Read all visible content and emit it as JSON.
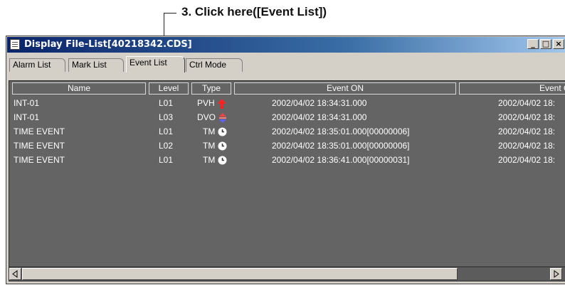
{
  "callout": {
    "text": "3. Click here([Event List])"
  },
  "window": {
    "title": "Display File-List[40218342.CDS]",
    "controls": {
      "minimize": "_",
      "maximize": "□",
      "close": "×"
    }
  },
  "tabs": [
    {
      "label": "Alarm List"
    },
    {
      "label": "Mark List"
    },
    {
      "label": "Event List"
    },
    {
      "label": "Ctrl Mode"
    }
  ],
  "table": {
    "columns": [
      "Name",
      "Level",
      "Type",
      "Event ON",
      "Event OFF"
    ],
    "rows": [
      {
        "name": "INT-01",
        "level": "L01",
        "type": "PVH",
        "icon": "up-arrow-icon",
        "icon_color": "#ff2020",
        "on": "2002/04/02 18:34:31.000",
        "off": "2002/04/02 18:"
      },
      {
        "name": "INT-01",
        "level": "L03",
        "type": "DVO",
        "icon": "updown-arrow-icon",
        "icon_color": "#ff4040",
        "on": "2002/04/02 18:34:31.000",
        "off": "2002/04/02 18:"
      },
      {
        "name": "TIME EVENT",
        "level": "L01",
        "type": "TM",
        "icon": "clock-icon",
        "icon_color": "#ffffff",
        "on": "2002/04/02 18:35:01.000[00000006]",
        "off": "2002/04/02 18:"
      },
      {
        "name": "TIME EVENT",
        "level": "L02",
        "type": "TM",
        "icon": "clock-icon",
        "icon_color": "#ffffff",
        "on": "2002/04/02 18:35:01.000[00000006]",
        "off": "2002/04/02 18:"
      },
      {
        "name": "TIME EVENT",
        "level": "L01",
        "type": "TM",
        "icon": "clock-icon",
        "icon_color": "#ffffff",
        "on": "2002/04/02 18:36:41.000[00000031]",
        "off": "2002/04/02 18:"
      }
    ]
  },
  "colors": {
    "list_bg": "#646464",
    "title_bar": "#0a246a"
  }
}
